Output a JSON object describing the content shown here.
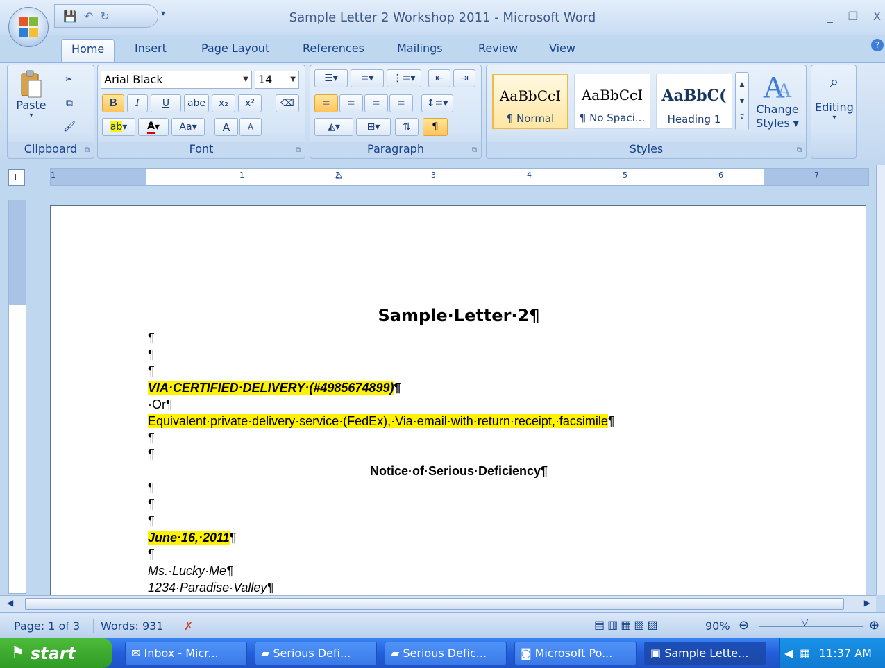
{
  "window": {
    "title": "Sample Letter 2 Workshop 2011 - Microsoft Word",
    "controls": [
      "_",
      "❐",
      "X"
    ]
  },
  "tabs": [
    {
      "label": "Home",
      "active": true
    },
    {
      "label": "Insert"
    },
    {
      "label": "Page Layout"
    },
    {
      "label": "References"
    },
    {
      "label": "Mailings"
    },
    {
      "label": "Review"
    },
    {
      "label": "View"
    }
  ],
  "ribbon": {
    "clipboard": {
      "label": "Clipboard",
      "paste": "Paste"
    },
    "font": {
      "label": "Font",
      "font_name": "Arial Black",
      "font_size": "14",
      "bold": "B",
      "italic": "I",
      "underline": "U",
      "strike": "abe",
      "subscript": "x₂",
      "superscript": "x²",
      "change_case": "Aa",
      "grow": "A",
      "shrink": "A"
    },
    "paragraph": {
      "label": "Paragraph",
      "show_marks": "¶"
    },
    "styles": {
      "label": "Styles",
      "items": [
        {
          "preview": "AaBbCcI",
          "name": "¶ Normal",
          "selected": true
        },
        {
          "preview": "AaBbCcI",
          "name": "¶ No Spaci..."
        },
        {
          "preview": "AaBbC(",
          "name": "Heading 1"
        }
      ],
      "change_styles": "Change Styles ▾"
    },
    "editing": {
      "label": "Editing"
    }
  },
  "ruler": {
    "numbers": [
      "1",
      "1",
      "2",
      "3",
      "4",
      "5",
      "6",
      "7"
    ]
  },
  "document": {
    "title": "Sample·Letter·2¶",
    "lines": [
      {
        "text": "¶"
      },
      {
        "text": "¶"
      },
      {
        "text": "¶"
      },
      {
        "text": "VIA·CERTIFIED·DELIVERY·(#4985674899)",
        "tail": "¶",
        "style": "bi",
        "highlight": true
      },
      {
        "text": "·Or¶"
      },
      {
        "text": "Equivalent·private·delivery·service·(FedEx),·Via·email·with·return·receipt,·facsimile",
        "tail": "¶",
        "highlight": true
      },
      {
        "text": "¶"
      },
      {
        "text": "¶"
      },
      {
        "text": "Notice·of·Serious·Deficiency¶",
        "style": "center"
      },
      {
        "text": "¶"
      },
      {
        "text": "¶"
      },
      {
        "text": "¶"
      },
      {
        "text": "June·16,·2011",
        "tail": "¶",
        "style": "bi",
        "highlight": true
      },
      {
        "text": "¶"
      },
      {
        "text": "Ms.·Lucky·Me¶",
        "style": "it"
      },
      {
        "text": "1234·Paradise·Valley¶",
        "style": "it"
      }
    ]
  },
  "status": {
    "page": "Page: 1 of 3",
    "words": "Words: 931",
    "zoom": "90%"
  },
  "taskbar": {
    "start": "start",
    "tasks": [
      {
        "label": "Inbox - Micr..."
      },
      {
        "label": "Serious Defi..."
      },
      {
        "label": "Serious Defic..."
      },
      {
        "label": "Microsoft Po..."
      },
      {
        "label": "Sample Lette...",
        "active": true
      }
    ],
    "clock": "11:37 AM"
  }
}
